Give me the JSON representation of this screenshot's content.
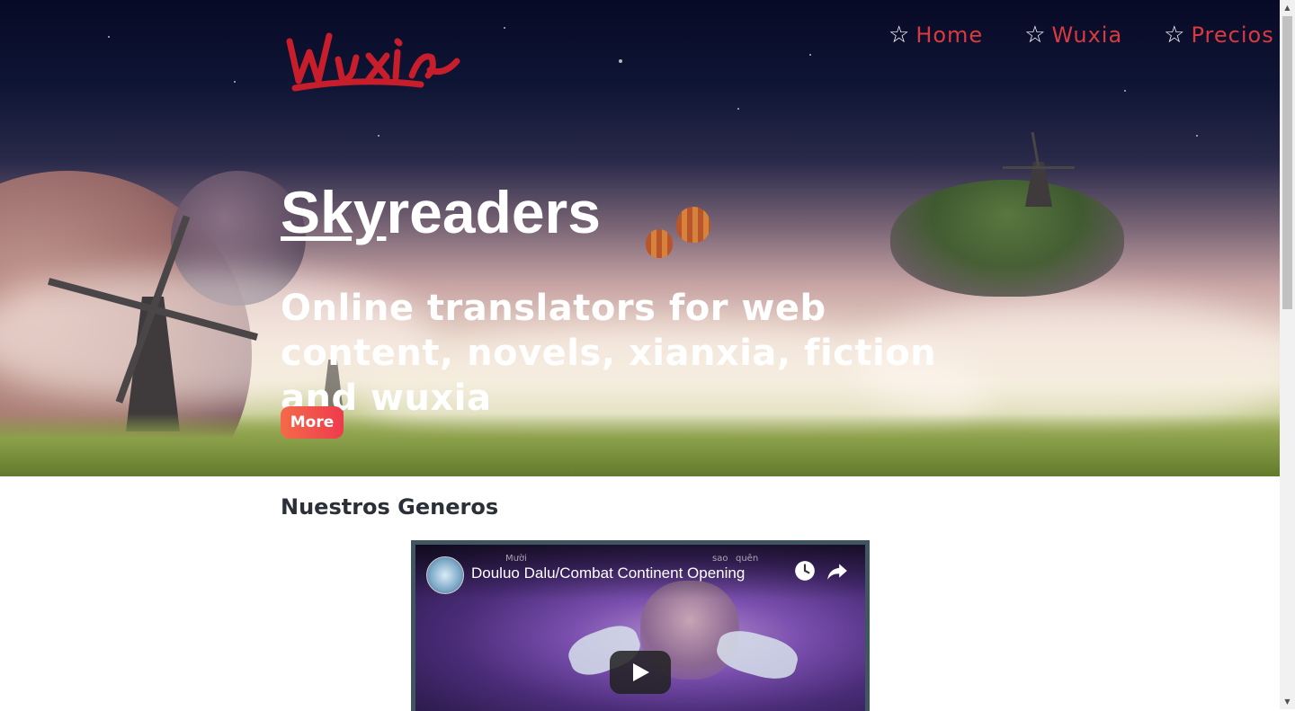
{
  "header": {
    "logo_text": "Wuxia",
    "nav": [
      {
        "icon": "star-outline-icon",
        "label": "Home"
      },
      {
        "icon": "star-outline-icon",
        "label": "Wuxia"
      },
      {
        "icon": "star-outline-icon",
        "label": "Precios"
      }
    ]
  },
  "hero": {
    "title_underlined": "Sky",
    "title_rest": "readers",
    "subtitle": "Online translators for web content, novels, xianxia, fiction and wuxia",
    "button_label": "More"
  },
  "section": {
    "title": "Nuestros Generos"
  },
  "video": {
    "title": "Douluo Dalu/Combat Continent Opening",
    "watch_later_icon": "clock-icon",
    "share_icon": "share-icon",
    "play_icon": "play-icon",
    "caption_fragments": [
      "Mười",
      "sao",
      "quên"
    ]
  },
  "colors": {
    "nav_text": "#d83a3f",
    "button_start": "#f36b4a",
    "button_end": "#ef3a4c",
    "section_title": "#2b3038"
  }
}
